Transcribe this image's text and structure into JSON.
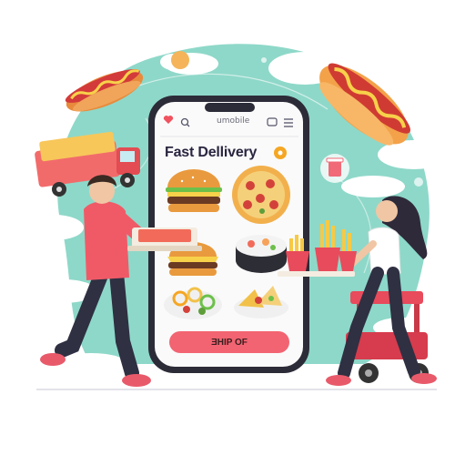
{
  "app": {
    "status_label": "umobile",
    "title": "Fast Dellivery",
    "cta_label": "ƎHIP OF"
  },
  "colors": {
    "sky_teal": "#8ed8c9",
    "accent_red": "#f0525f",
    "accent_orange": "#f5a623",
    "phone_frame": "#2c2b38",
    "screen_bg": "#fafafa",
    "shirt_pink": "#f05a67",
    "pants_dark": "#2f3042"
  },
  "icons": [
    "heart-icon",
    "search-icon",
    "message-icon",
    "menu-icon",
    "cart-icon"
  ],
  "food_items": [
    "burger",
    "pizza",
    "sushi-roll",
    "cheese-burger",
    "pasta-salad",
    "nachos"
  ]
}
